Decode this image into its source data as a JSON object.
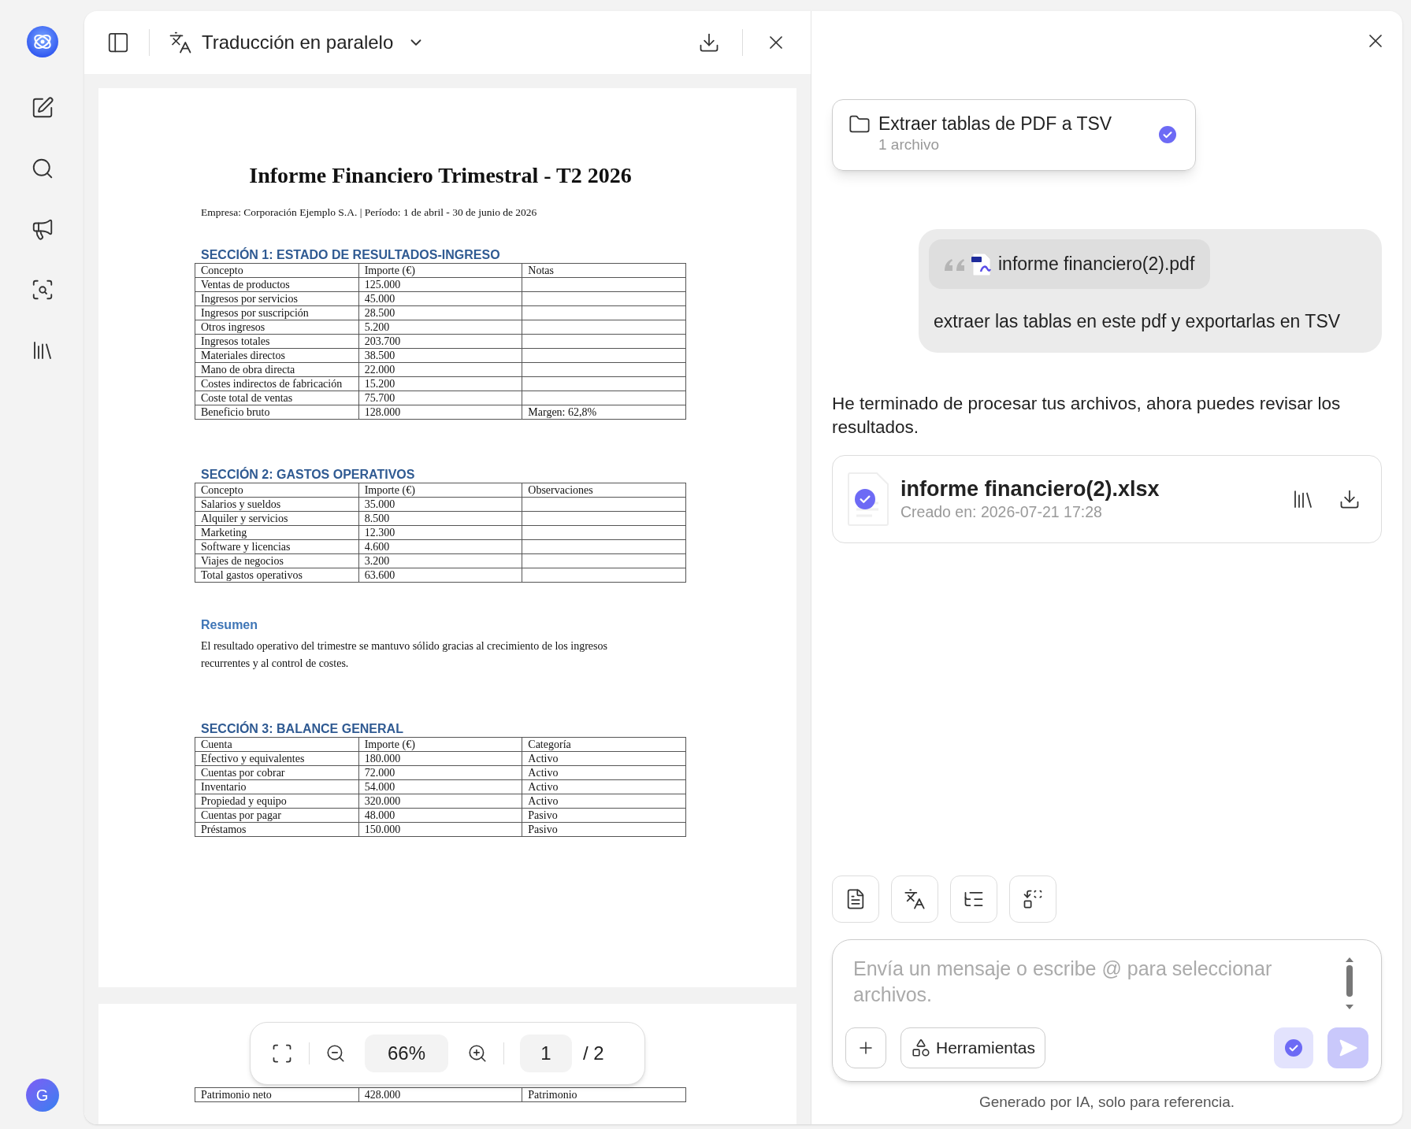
{
  "rail": {
    "avatar": "G"
  },
  "viewer": {
    "title": "Traducción en paralelo",
    "document": {
      "title": "Informe Financiero Trimestral - T2 2026",
      "subtitle": "Empresa: Corporación Ejemplo S.A. | Período: 1 de abril - 30 de junio de 2026",
      "blocks": [
        {
          "kind": "table",
          "heading": "SECCIÓN 1: ESTADO DE RESULTADOS-INGRESO",
          "columns": [
            "Concepto",
            "Importe (€)",
            "Notas"
          ],
          "rows": [
            [
              "Ventas de productos",
              "125.000"
            ],
            [
              "Ingresos por servicios",
              "45.000"
            ],
            [
              "Ingresos por suscripción",
              "28.500"
            ],
            [
              "Otros ingresos",
              "5.200"
            ],
            [
              "Ingresos totales",
              "203.700"
            ],
            [
              "Materiales directos",
              "38.500"
            ],
            [
              "Mano de obra directa",
              "22.000"
            ],
            [
              "Costes indirectos de fabricación",
              "15.200"
            ],
            [
              "Coste total de ventas",
              "75.700"
            ],
            [
              "Beneficio bruto",
              "128.000",
              "Margen: 62,8%"
            ]
          ]
        },
        {
          "kind": "table",
          "heading": "SECCIÓN 2: GASTOS OPERATIVOS",
          "columns": [
            "Concepto",
            "Importe (€)",
            "Observaciones"
          ],
          "rows": [
            [
              "Salarios y sueldos",
              "35.000"
            ],
            [
              "Alquiler y servicios",
              "8.500"
            ],
            [
              "Marketing",
              "12.300"
            ],
            [
              "Software y licencias",
              "4.600"
            ],
            [
              "Viajes de negocios",
              "3.200"
            ],
            [
              "Total gastos operativos",
              "63.600"
            ]
          ]
        },
        {
          "kind": "text",
          "heading": "Resumen",
          "text": "El resultado operativo del trimestre se mantuvo sólido gracias al crecimiento de los ingresos recurrentes y al control de costes."
        },
        {
          "kind": "table",
          "heading": "SECCIÓN 3: BALANCE GENERAL",
          "columns": [
            "Cuenta",
            "Importe (€)",
            "Categoría"
          ],
          "rows": [
            [
              "Efectivo y equivalentes",
              "180.000",
              "Activo"
            ],
            [
              "Cuentas por cobrar",
              "72.000",
              "Activo"
            ],
            [
              "Inventario",
              "54.000",
              "Activo"
            ],
            [
              "Propiedad y equipo",
              "320.000",
              "Activo"
            ],
            [
              "Cuentas por pagar",
              "48.000",
              "Pasivo"
            ],
            [
              "Préstamos",
              "150.000",
              "Pasivo"
            ]
          ]
        }
      ],
      "page_2_rows": [
        [
          "Patrimonio neto",
          "428.000",
          "Patrimonio"
        ]
      ]
    },
    "toolbar": {
      "zoom": "66%",
      "page": "1",
      "total": "/ 2"
    }
  },
  "chat": {
    "task": {
      "title": "Extraer tablas de PDF a TSV",
      "subtitle": "1 archivo",
      "done": true
    },
    "user_message": {
      "attachment": "informe financiero(2).pdf",
      "text": "extraer las tablas en este pdf y exportarlas en TSV"
    },
    "reply": "He terminado de procesar tus archivos, ahora puedes revisar los resultados.",
    "result_file": {
      "name": "informe financiero(2).xlsx",
      "created": "Creado en: 2026-07-21 17:28",
      "done": true
    },
    "input": {
      "placeholder": "Envía un mensaje o escribe @ para seleccionar archivos."
    },
    "tools_button": "Herramientas",
    "mode_button": {
      "on": true
    },
    "send_button": {
      "disabled": true
    },
    "footer": "Generado por IA, solo para referencia."
  }
}
